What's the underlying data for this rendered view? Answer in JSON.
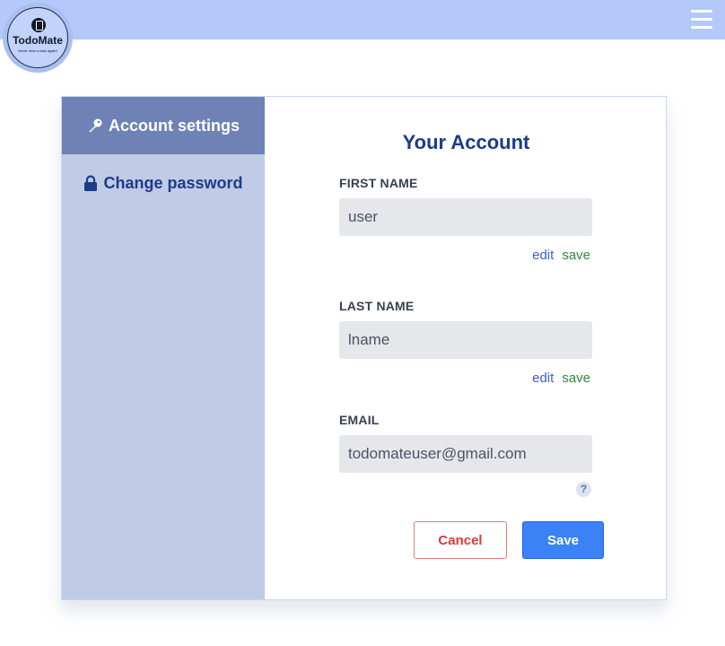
{
  "header": {
    "logo_title": "TodoMate",
    "logo_tagline": "Never miss a task again!"
  },
  "sidebar": {
    "items": [
      {
        "label": "Account settings",
        "icon": "key-icon",
        "active": true
      },
      {
        "label": "Change password",
        "icon": "lock-icon",
        "active": false
      }
    ]
  },
  "main": {
    "title": "Your Account",
    "fields": [
      {
        "label": "FIRST NAME",
        "value": "user",
        "edit_label": "edit",
        "save_label": "save"
      },
      {
        "label": "LAST NAME",
        "value": "lname",
        "edit_label": "edit",
        "save_label": "save"
      },
      {
        "label": "EMAIL",
        "value": "todomateuser@gmail.com",
        "help": "?"
      }
    ],
    "cancel_label": "Cancel",
    "save_label": "Save"
  },
  "colors": {
    "topbar": "#b4c8fa",
    "sidebar": "#c0cbe5",
    "sidebar_active": "#6f82b6",
    "title": "#1e3a8a",
    "save_button": "#3b82f6",
    "cancel": "#dc3b3b"
  }
}
